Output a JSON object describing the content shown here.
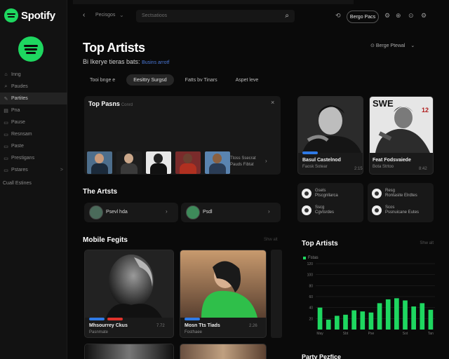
{
  "app": {
    "brand": "Spotify"
  },
  "sidebar": {
    "items": [
      {
        "icon": "home-icon",
        "label": "Inng",
        "active": false
      },
      {
        "icon": "search-icon",
        "label": "Paudes",
        "active": false
      },
      {
        "icon": "edit-icon",
        "label": "Partites",
        "active": true
      },
      {
        "icon": "library-icon",
        "label": "Pna",
        "active": false
      },
      {
        "icon": "list-icon",
        "label": "Pause",
        "active": false
      },
      {
        "icon": "list-icon",
        "label": "Resnsam",
        "active": false
      },
      {
        "icon": "list-icon",
        "label": "Paste",
        "active": false
      },
      {
        "icon": "list-icon",
        "label": "Prestigans",
        "active": false
      },
      {
        "icon": "list-icon",
        "label": "Pstares",
        "active": false,
        "chevron": ">"
      }
    ],
    "footer": "Cuall Estines"
  },
  "topbar": {
    "back": "‹",
    "crumb": "Pecisgos",
    "crumb_chevron": "⌄",
    "search_placeholder": "Sectsatioos",
    "search_icon": "⌕",
    "icons": [
      "⟲",
      "⚙",
      "⊕",
      "⊙",
      "⚙"
    ],
    "button": "Bergo Pacs"
  },
  "header": {
    "title": "Top Artists",
    "subtitle": "Bi Ikerye tieras bats:",
    "subtitle_link": "Busins arrotf",
    "sort": "Berge Ptewal",
    "sort_chevron": "⌄"
  },
  "filters": [
    {
      "label": "Tooi bnge e",
      "active": false
    },
    {
      "label": "Eesittry Surgsd",
      "active": true
    },
    {
      "label": "Fatts bv Tinars",
      "active": false
    },
    {
      "label": "Aspet leve",
      "active": false
    }
  ],
  "top_albums": {
    "title": "Top Pasns",
    "title_muted": "Conrd",
    "close": "×",
    "caption": [
      "Ttoss Ssecrat",
      "Pauds Fibtat"
    ],
    "chevron": "›",
    "thumbs": [
      {
        "bg": "#4d6e8c",
        "head": "#c99a7a",
        "body": "#1b2a3a"
      },
      {
        "bg": "#1d1d1d",
        "head": "#caa78a",
        "body": "#3a3a3a"
      },
      {
        "bg": "#e8e8e8",
        "head": "#222222",
        "body": "#111111"
      },
      {
        "bg": "#7a2b2b",
        "head": "#6b4030",
        "body": "#b03020"
      },
      {
        "bg": "#5a84b0",
        "head": "#8a6040",
        "body": "#2a3c55"
      }
    ]
  },
  "the_artists": {
    "title": "The Artsts",
    "items": [
      {
        "label": "Psevl hda",
        "avatar": "#4a6a5a",
        "chevron": "›"
      },
      {
        "label": "Psdl",
        "avatar": "#3e8a5a",
        "chevron": "›"
      }
    ]
  },
  "mobile": {
    "title": "Mobile Fegits",
    "more": "Shw alt",
    "cards": [
      {
        "title": "Mhsourrey Ckus",
        "meta": "Pasnmate",
        "num": "7.72",
        "bg": "#8a8a8a",
        "progress": [
          "#2f7ae6",
          "#e0332c"
        ]
      },
      {
        "title": "Mosn Tts Tiads",
        "meta": "Fosthaee",
        "num": "2.26",
        "bg": "#b08060",
        "progress": [
          "#2f7ae6"
        ]
      }
    ]
  },
  "right_artists": [
    {
      "title": "Basul Castelnod",
      "meta": "Faosk Sotear",
      "num": "2:15",
      "progress": "#2f7ae6"
    },
    {
      "title": "Feat Fodsvaiede",
      "meta": "Bota Strtoo",
      "num": "8:42",
      "banner_text": "SWE",
      "banner_num": "12",
      "progress": ""
    }
  ],
  "right_lists": [
    {
      "rows": [
        "Gsels",
        "Ptscgnllarca",
        "Sscg",
        "Cgvtsrdes"
      ]
    },
    {
      "rows": [
        "Resg",
        "Rontasite Elrdtes",
        "Scos",
        "Pssnuicane Eutes"
      ]
    }
  ],
  "chart_data": {
    "type": "bar",
    "title": "Top Artists",
    "more": "Shw alt",
    "legend": "Fstas",
    "categories": [
      "May",
      "",
      "",
      "Sbt",
      "",
      "",
      "Pse",
      "",
      "",
      "",
      "Sot",
      "",
      "",
      "Tan"
    ],
    "values": [
      40,
      18,
      25,
      27,
      35,
      33,
      31,
      48,
      55,
      57,
      53,
      42,
      48,
      36
    ],
    "ylim": [
      0,
      120
    ],
    "yticks": [
      "120",
      "100",
      "80",
      "60",
      "40",
      "20"
    ],
    "colors": {
      "bar": "#1ed760",
      "grid": "#2a2a2a"
    }
  },
  "bottom_heading": "Party Pezfice"
}
